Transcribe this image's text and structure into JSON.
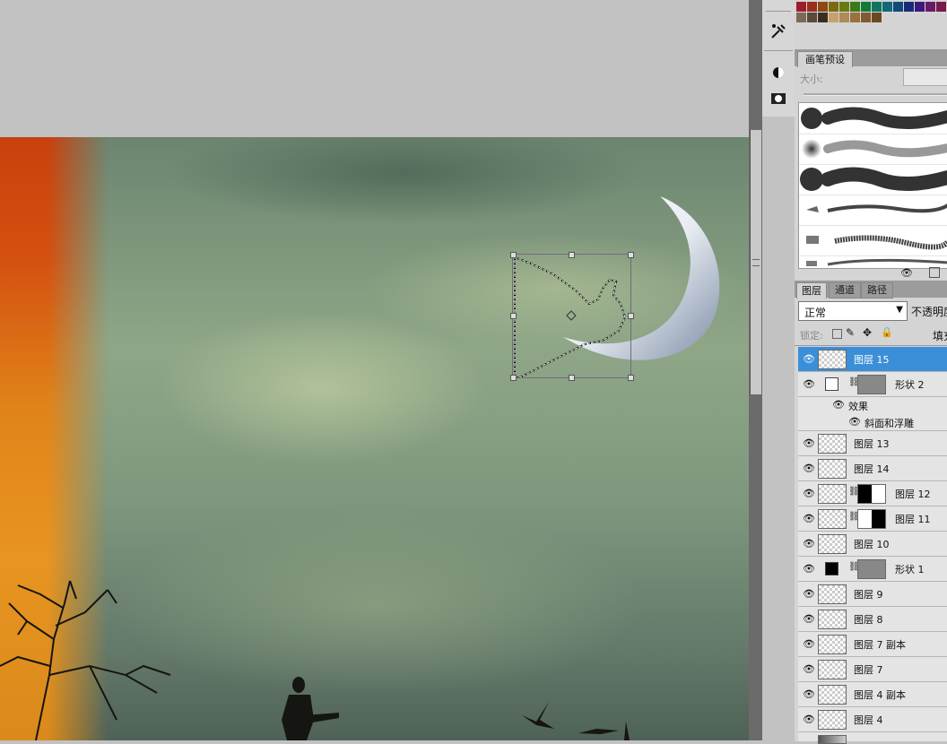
{
  "brush_panel": {
    "tab": "画笔预设",
    "size_label": "大小:"
  },
  "layers_panel": {
    "tabs": [
      "图层",
      "通道",
      "路径"
    ],
    "blend_mode": "正常",
    "opacity_label": "不透明度",
    "lock_label": "锁定:",
    "fill_label": "填充"
  },
  "layers": [
    {
      "name": "图层 15",
      "selected": true
    },
    {
      "name": "形状 2"
    },
    {
      "name": "效果"
    },
    {
      "name": "斜面和浮雕"
    },
    {
      "name": "图层 13"
    },
    {
      "name": "图层 14"
    },
    {
      "name": "图层 12"
    },
    {
      "name": "图层 11"
    },
    {
      "name": "图层 10"
    },
    {
      "name": "形状 1"
    },
    {
      "name": "图层 9"
    },
    {
      "name": "图层 8"
    },
    {
      "name": "图层 7 副本"
    },
    {
      "name": "图层 7"
    },
    {
      "name": "图层 4 副本"
    },
    {
      "name": "图层 4"
    }
  ],
  "colors": {
    "selection_blue": "#3a8fd8",
    "panel_gray": "#d4d4d4",
    "workspace_gray": "#c2c2c2"
  },
  "icons": [
    "eye-icon",
    "chain-link-icon",
    "lock-icon",
    "brush-icon",
    "move-icon",
    "dropdown-arrow-icon"
  ]
}
